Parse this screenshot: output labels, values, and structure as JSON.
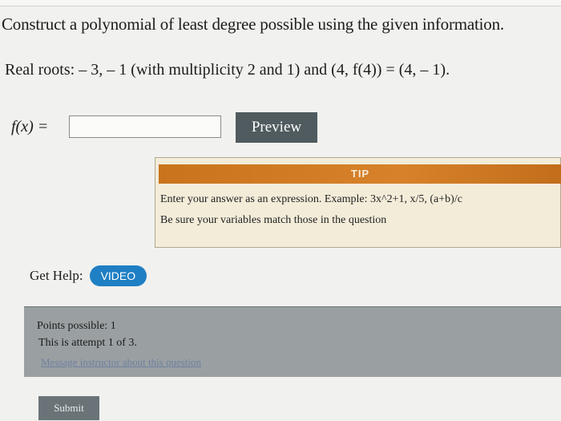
{
  "question": {
    "prompt": "Construct a polynomial of least degree possible using the given information.",
    "roots": "Real roots: – 3,  – 1 (with multiplicity 2 and 1) and (4, f(4)) = (4,  – 1)."
  },
  "answer": {
    "label": "f(x) =",
    "value": "",
    "preview_label": "Preview"
  },
  "tip": {
    "header": "TIP",
    "line1": "Enter your answer as an expression. Example: 3x^2+1, x/5, (a+b)/c",
    "line2": "Be sure your variables match those in the question"
  },
  "help": {
    "label": "Get Help:",
    "video_label": "VIDEO"
  },
  "info": {
    "points": "Points possible: 1",
    "attempt": "This is attempt 1 of 3.",
    "message_link": "Message instructor about this question"
  },
  "submit_label": "Submit",
  "colors": {
    "preview_bg": "#4f5b5e",
    "tip_header": "#d7822a",
    "video_bg": "#1f7fc4",
    "info_panel": "#9aa0a2"
  }
}
